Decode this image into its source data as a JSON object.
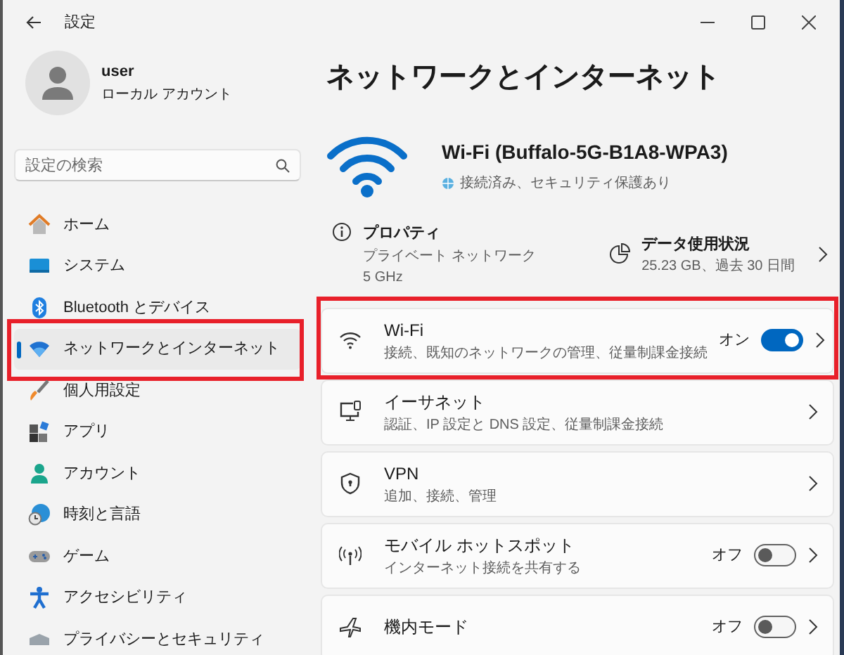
{
  "window": {
    "title": "設定"
  },
  "user": {
    "name": "user",
    "account_type": "ローカル アカウント"
  },
  "search": {
    "placeholder": "設定の検索"
  },
  "nav": [
    {
      "label": "ホーム",
      "selected": false,
      "highlighted": false
    },
    {
      "label": "システム",
      "selected": false,
      "highlighted": false
    },
    {
      "label": "Bluetooth とデバイス",
      "selected": false,
      "highlighted": false
    },
    {
      "label": "ネットワークとインターネット",
      "selected": true,
      "highlighted": true
    },
    {
      "label": "個人用設定",
      "selected": false,
      "highlighted": false
    },
    {
      "label": "アプリ",
      "selected": false,
      "highlighted": false
    },
    {
      "label": "アカウント",
      "selected": false,
      "highlighted": false
    },
    {
      "label": "時刻と言語",
      "selected": false,
      "highlighted": false
    },
    {
      "label": "ゲーム",
      "selected": false,
      "highlighted": false
    },
    {
      "label": "アクセシビリティ",
      "selected": false,
      "highlighted": false
    },
    {
      "label": "プライバシーとセキュリティ",
      "selected": false,
      "highlighted": false
    }
  ],
  "main": {
    "title": "ネットワークとインターネット",
    "connection": {
      "name": "Wi-Fi (Buffalo-5G-B1A8-WPA3)",
      "status": "接続済み、セキュリティ保護あり"
    },
    "properties": {
      "title": "プロパティ",
      "lines": [
        "プライベート ネットワーク",
        "5 GHz"
      ]
    },
    "data_usage": {
      "title": "データ使用状況",
      "detail": "25.23 GB、過去 30 日間"
    },
    "settings": [
      {
        "kind": "toggle",
        "title": "Wi-Fi",
        "description": "接続、既知のネットワークの管理、従量制課金接続",
        "toggle": {
          "label": "オン",
          "on": true
        },
        "highlighted": true
      },
      {
        "kind": "link",
        "title": "イーサネット",
        "description": "認証、IP 設定と DNS 設定、従量制課金接続",
        "highlighted": false
      },
      {
        "kind": "link",
        "title": "VPN",
        "description": "追加、接続、管理",
        "highlighted": false
      },
      {
        "kind": "toggle",
        "title": "モバイル ホットスポット",
        "description": "インターネット接続を共有する",
        "toggle": {
          "label": "オフ",
          "on": false
        },
        "highlighted": false
      },
      {
        "kind": "toggle",
        "title": "機内モード",
        "toggle": {
          "label": "オフ",
          "on": false
        },
        "highlighted": false
      }
    ]
  }
}
